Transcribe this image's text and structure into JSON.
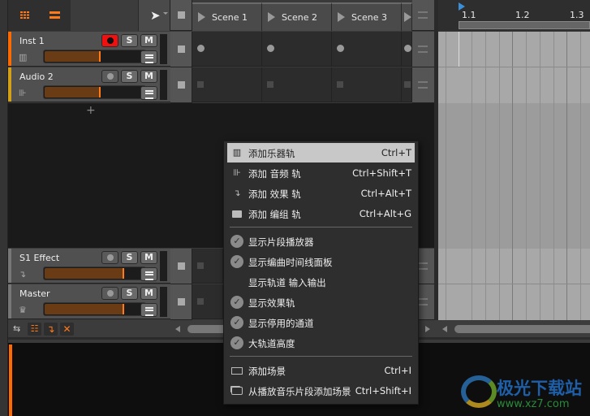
{
  "header": {
    "view_icons": [
      "grid-icon",
      "list-icon"
    ],
    "tool": "pointer-icon"
  },
  "scenes": [
    "Scene 1",
    "Scene 2",
    "Scene 3"
  ],
  "tracks": [
    {
      "name": "Inst 1",
      "color": "#ff6a00",
      "icon": "piano-icon",
      "armed": true,
      "solo": "S",
      "mute": "M",
      "volume": 0.55
    },
    {
      "name": "Audio 2",
      "color": "#d4a017",
      "icon": "waveform-icon",
      "armed": false,
      "solo": "S",
      "mute": "M",
      "volume": 0.55
    }
  ],
  "fx_tracks": [
    {
      "name": "S1 Effect",
      "icon": "return-arrow-icon",
      "solo": "S",
      "mute": "M",
      "volume": 0.78
    },
    {
      "name": "Master",
      "icon": "crown-icon",
      "solo": "S",
      "mute": "M",
      "volume": 0.78
    }
  ],
  "add_track": "+",
  "ruler": {
    "labels": [
      "1.1",
      "1.2",
      "1.3"
    ]
  },
  "context_menu": {
    "add_items": [
      {
        "icon": "piano-icon",
        "label": "添加乐器轨",
        "shortcut": "Ctrl+T",
        "highlighted": true
      },
      {
        "icon": "waveform-icon",
        "label": "添加 音频 轨",
        "shortcut": "Ctrl+Shift+T"
      },
      {
        "icon": "return-arrow-icon",
        "label": "添加 效果 轨",
        "shortcut": "Ctrl+Alt+T"
      },
      {
        "icon": "folder-icon",
        "label": "添加 编组 轨",
        "shortcut": "Ctrl+Alt+G"
      }
    ],
    "toggle_items": [
      {
        "label": "显示片段播放器",
        "checked": true
      },
      {
        "label": "显示编曲时间线面板",
        "checked": true
      },
      {
        "label": "显示轨道 输入输出",
        "checked": false
      },
      {
        "label": "显示效果轨",
        "checked": true
      },
      {
        "label": "显示停用的通道",
        "checked": true
      },
      {
        "label": "大轨道高度",
        "checked": true
      }
    ],
    "scene_items": [
      {
        "icon": "scene-icon",
        "label": "添加场景",
        "shortcut": "Ctrl+I"
      },
      {
        "icon": "scene-from-clips-icon",
        "label": "从播放音乐片段添加场景",
        "shortcut": "Ctrl+Shift+I"
      }
    ]
  },
  "watermark": {
    "text": "极光下载站",
    "url": "www.xz7.com"
  },
  "colors": {
    "accent": "#ff7b1a",
    "record": "#f01010",
    "playhead": "#3a8fd8"
  }
}
